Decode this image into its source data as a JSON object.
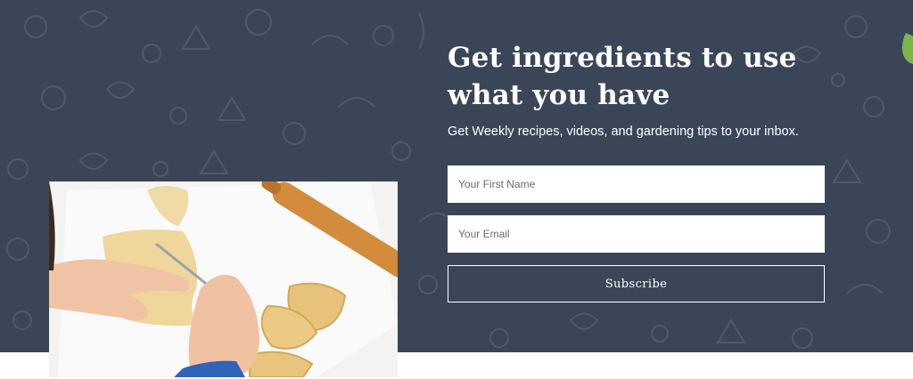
{
  "newsletter": {
    "headline": "Get ingredients to use what you have",
    "subtitle": "Get Weekly recipes, videos, and gardening tips to your inbox.",
    "first_name_placeholder": "Your First Name",
    "email_placeholder": "Your Email",
    "subscribe_label": "Subscribe"
  },
  "colors": {
    "band_background": "#3a4658",
    "text": "#ffffff",
    "accent_leaf": "#7ab648"
  },
  "icons": [
    "vegetable-doodle-pattern",
    "leaf-icon"
  ]
}
